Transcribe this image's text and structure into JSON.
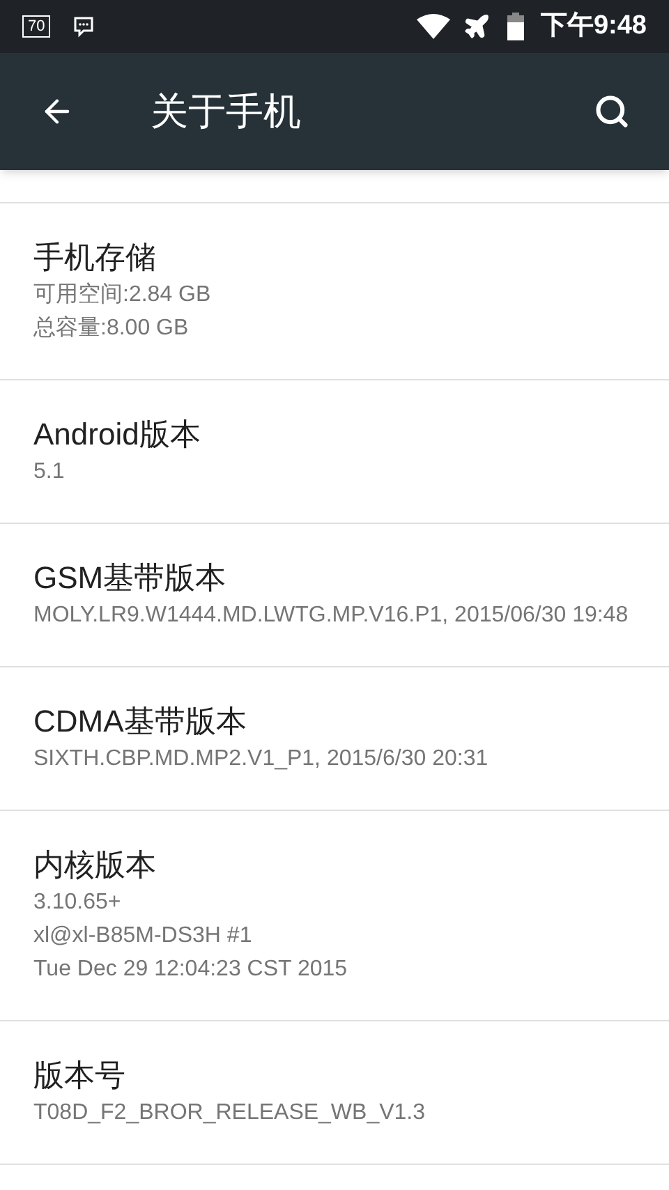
{
  "status_bar": {
    "badge": "70",
    "time": "下午9:48"
  },
  "toolbar": {
    "title": "关于手机"
  },
  "items": [
    {
      "title": "手机存储",
      "lines": [
        "可用空间:2.84 GB",
        "总容量:8.00 GB"
      ]
    },
    {
      "title": "Android版本",
      "lines": [
        "5.1"
      ]
    },
    {
      "title": "GSM基带版本",
      "lines": [
        "MOLY.LR9.W1444.MD.LWTG.MP.V16.P1, 2015/06/30 19:48"
      ]
    },
    {
      "title": "CDMA基带版本",
      "lines": [
        "SIXTH.CBP.MD.MP2.V1_P1, 2015/6/30 20:31"
      ]
    },
    {
      "title": "内核版本",
      "lines": [
        "3.10.65+",
        "xl@xl-B85M-DS3H #1",
        "Tue Dec 29 12:04:23 CST 2015"
      ]
    },
    {
      "title": "版本号",
      "lines": [
        "T08D_F2_BROR_RELEASE_WB_V1.3"
      ]
    }
  ]
}
